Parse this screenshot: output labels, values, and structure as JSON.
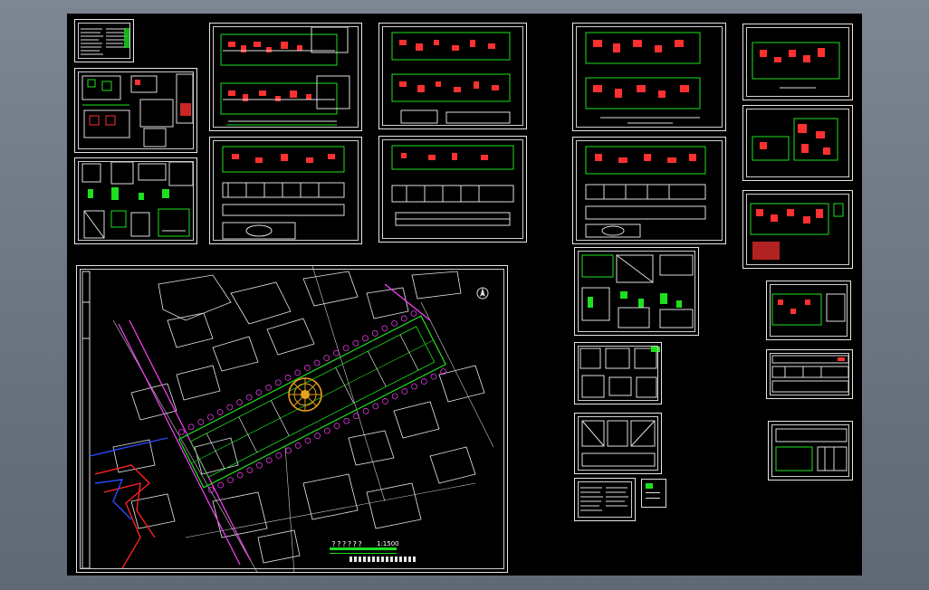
{
  "site_plan": {
    "title": "??????",
    "scale": "1:1500"
  },
  "colors": {
    "background": "#6f7984",
    "canvas": "#000000",
    "frame": "#e6e6e6",
    "wall": "#ffffff",
    "dimension": "#1ee01e",
    "hatch": "#ff3030",
    "road": "#ff40ff",
    "river": "#ff2020",
    "water": "#2b4bff",
    "plaza": "#e6a21e"
  }
}
